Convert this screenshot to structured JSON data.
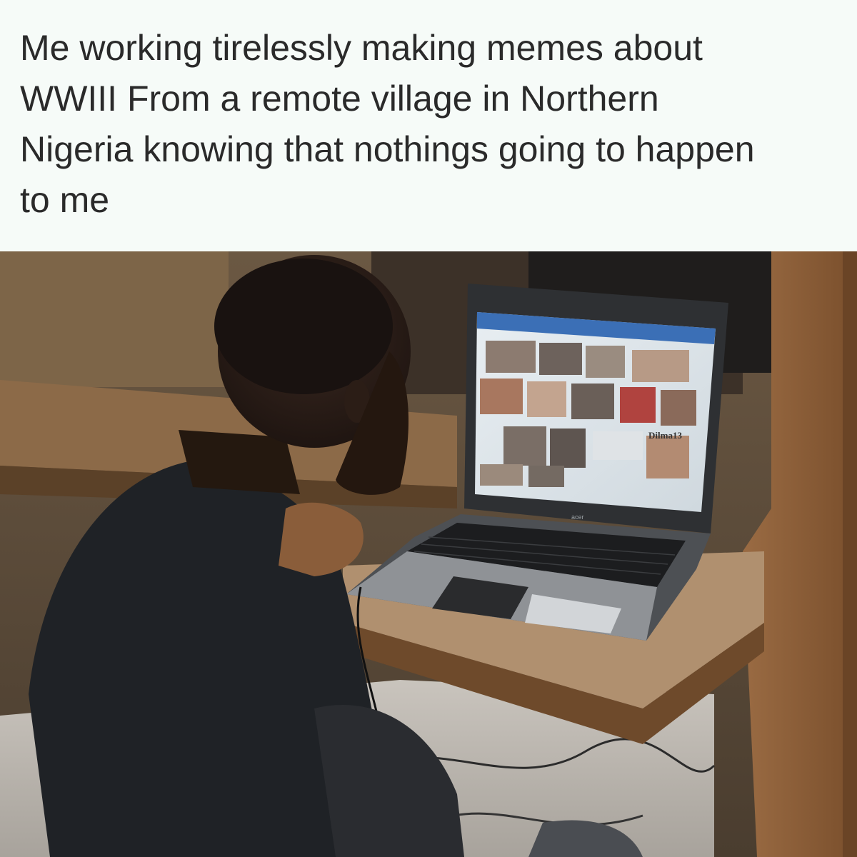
{
  "meme": {
    "caption": "Me working tirelessly making memes about\nWWIII From a remote village in Northern\nNigeria knowing that nothings going to happen\nto me",
    "photo": {
      "laptop_brand": "acer",
      "screen_tag": "Dilma13"
    }
  },
  "colors": {
    "background": "#f6fbf8",
    "caption_text": "#2a2a2a",
    "wood": "#8a5a34",
    "shirt": "#1f2226",
    "laptop_body": "#3a3d40"
  }
}
